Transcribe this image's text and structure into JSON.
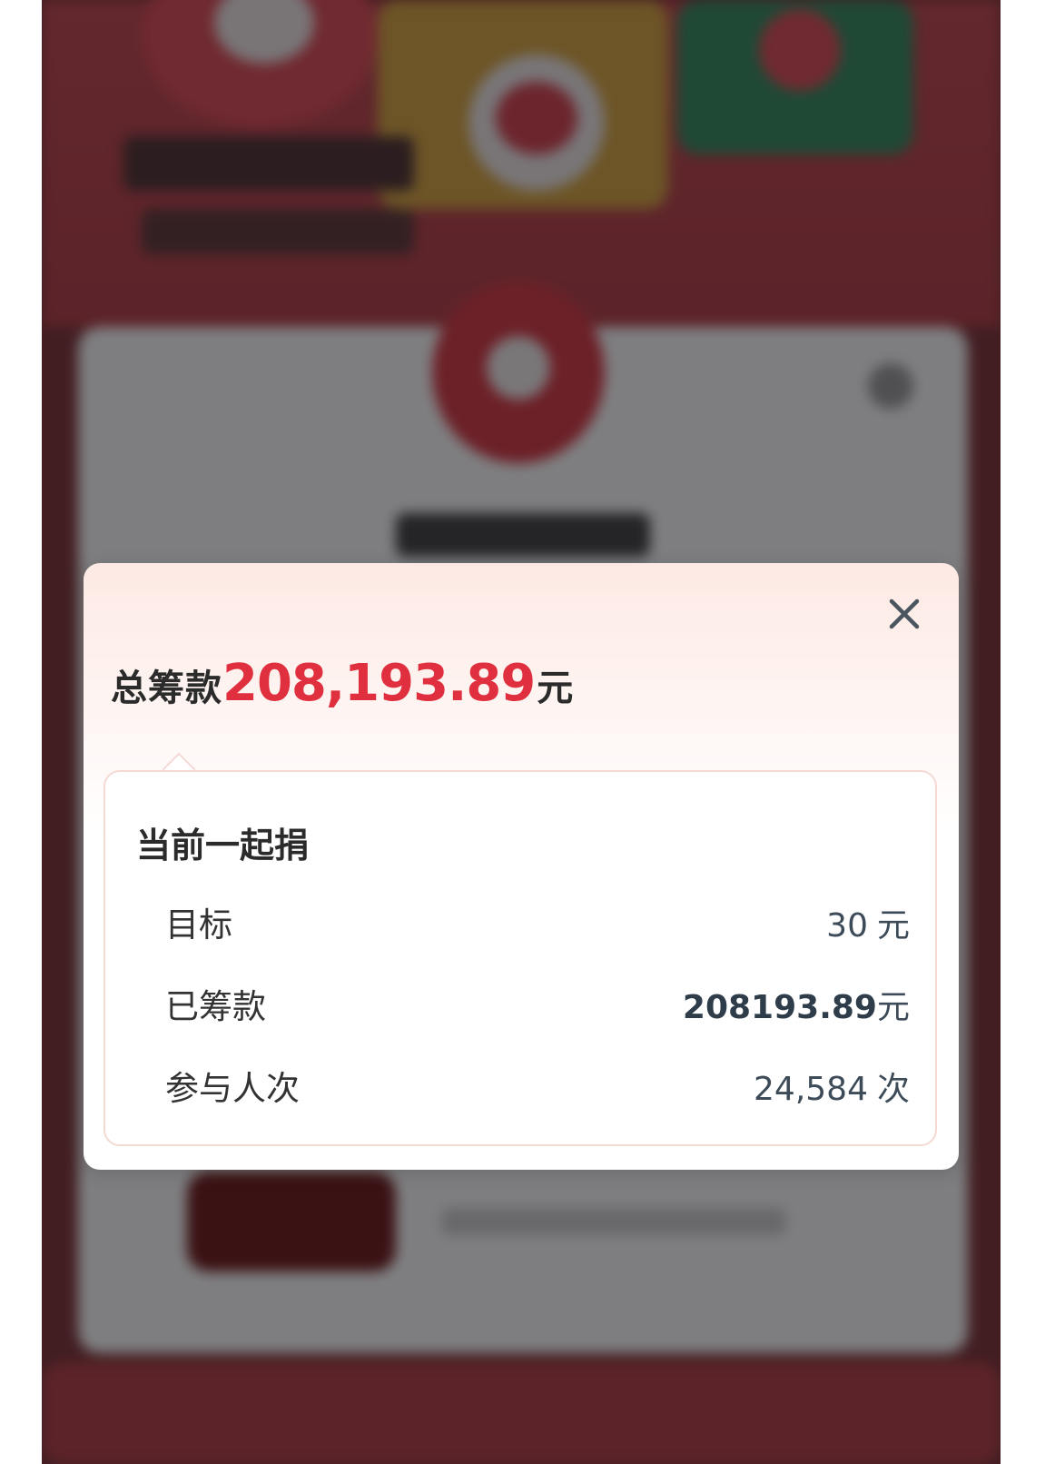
{
  "colors": {
    "accent": "#e0303f",
    "text_dark": "#2b2b2b",
    "value_text": "#3d4b58"
  },
  "modal": {
    "close_icon": "close-icon",
    "total": {
      "label": "总筹款",
      "amount": "208,193.89",
      "unit": "元"
    },
    "panel": {
      "title": "当前一起捐",
      "rows": [
        {
          "label": "目标",
          "value": "30",
          "unit": "元"
        },
        {
          "label": "已筹款",
          "value": "208193.89",
          "unit": "元"
        },
        {
          "label": "参与人次",
          "value": "24,584",
          "unit": "次"
        }
      ]
    }
  }
}
